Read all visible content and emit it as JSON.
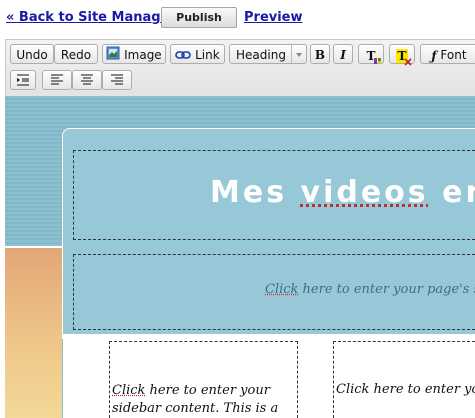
{
  "nav": {
    "back_label": "« Back to Site Manager",
    "publish_label": "Publish",
    "preview_label": "Preview"
  },
  "toolbar": {
    "undo": "Undo",
    "redo": "Redo",
    "image": "Image",
    "link": "Link",
    "heading": "Heading",
    "bold": "B",
    "italic": "I",
    "text_color": "T",
    "clear_format": "T",
    "font": "Font",
    "icons": {
      "image": "image-icon",
      "link": "link-icon",
      "heading_dropdown": "chevron-down-icon",
      "text_color": "text-color-icon",
      "clear_format": "clear-format-icon",
      "font": "font-icon",
      "indent": "indent-icon",
      "align_left": "align-left-icon",
      "align_center": "align-center-icon",
      "align_right": "align-right-icon"
    }
  },
  "page": {
    "site_title_word1": "Mes",
    "site_title_word2": "videos",
    "site_title_word3": "en s",
    "subtitle_lead": "Click",
    "subtitle_rest": " here to enter your page's sub",
    "sidebar_lead": "Click",
    "sidebar_rest": " here to enter your sidebar content. This is a",
    "main_text": "Click here to enter your"
  },
  "colors": {
    "link": "#1a1aa6",
    "header_bg": "#97c8d7",
    "canvas_bg": "#8bc0d0",
    "title_text": "#ffffff",
    "subtitle_text": "#3a6f86",
    "sidebar_gradient_top": "#e3a777"
  }
}
